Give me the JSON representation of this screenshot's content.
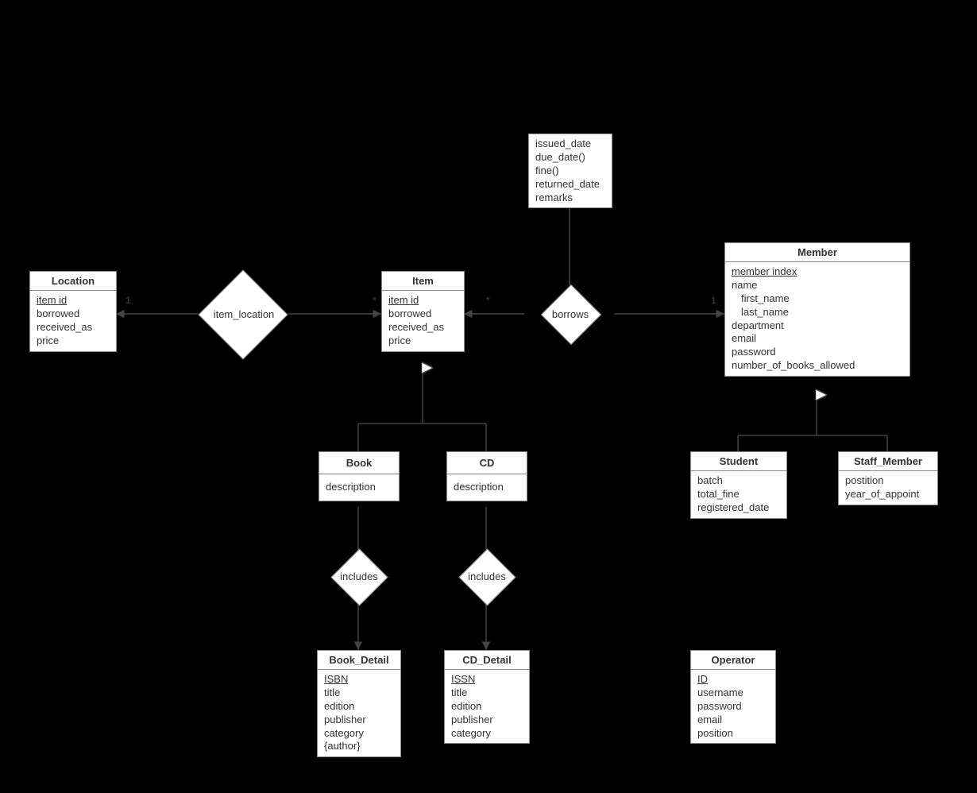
{
  "entities": {
    "location": {
      "title": "Location",
      "attrs": [
        "item id",
        "borrowed",
        "received_as",
        "price"
      ],
      "key": "item id"
    },
    "item": {
      "title": "Item",
      "attrs": [
        "item id",
        "borrowed",
        "received_as",
        "price"
      ],
      "key": "item id"
    },
    "borrows_attrs": {
      "attrs": [
        "issued_date",
        "due_date()",
        "fine()",
        "returned_date",
        "remarks"
      ]
    },
    "member": {
      "title": "Member",
      "attrs": [
        "member index",
        "name",
        "first_name",
        "last_name",
        "department",
        "email",
        "password",
        "number_of_books_allowed"
      ],
      "key": "member index",
      "indented": [
        "first_name",
        "last_name"
      ]
    },
    "book": {
      "title": "Book",
      "attrs": [
        "description"
      ]
    },
    "cd": {
      "title": "CD",
      "attrs": [
        "description"
      ]
    },
    "student": {
      "title": "Student",
      "attrs": [
        "batch",
        "total_fine",
        "registered_date"
      ]
    },
    "staff_member": {
      "title": "Staff_Member",
      "attrs": [
        "postition",
        "year_of_appoint"
      ]
    },
    "book_detail": {
      "title": "Book_Detail",
      "attrs": [
        "ISBN",
        "title",
        "edition",
        "publisher",
        "category",
        "{author}"
      ],
      "key": "ISBN"
    },
    "cd_detail": {
      "title": "CD_Detail",
      "attrs": [
        "ISSN",
        "title",
        "edition",
        "publisher",
        "category"
      ],
      "key": "ISSN"
    },
    "operator": {
      "title": "Operator",
      "attrs": [
        "ID",
        "username",
        "password",
        "email",
        "position"
      ],
      "key": "ID"
    }
  },
  "relationships": {
    "item_location": "item_location",
    "borrows": "borrows",
    "includes_book": "includes",
    "includes_cd": "includes"
  },
  "cardinalities": {
    "loc_one": "1",
    "item_left_star": "*",
    "item_right_star": "*",
    "member_one": "1"
  }
}
